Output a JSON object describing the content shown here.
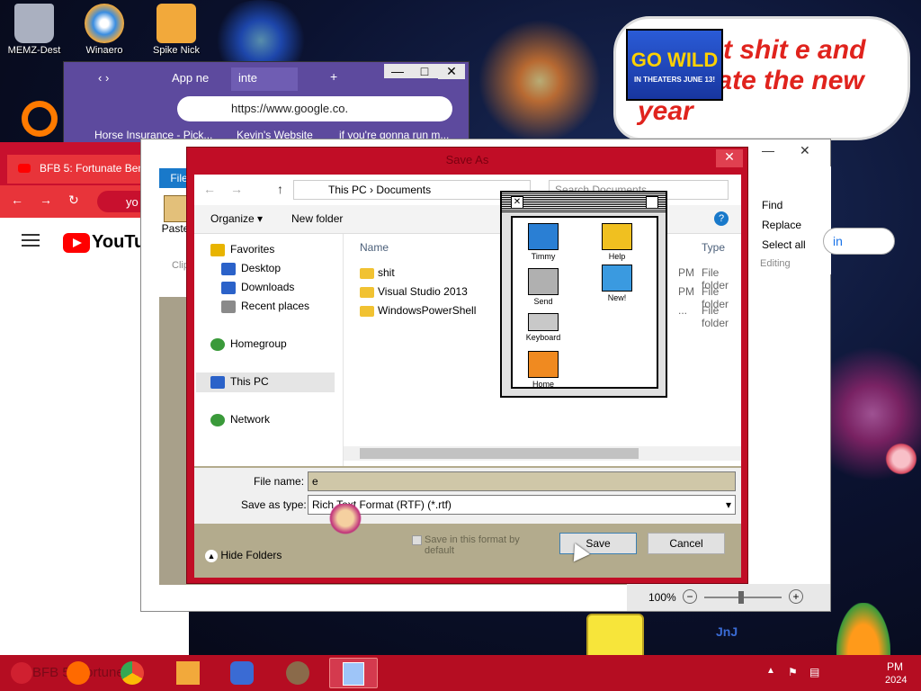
{
  "desktop": {
    "icons": [
      {
        "label": "MEMZ-Dest",
        "color": "#aab0c0"
      },
      {
        "label": "Winaero",
        "color": "#3a8de0"
      },
      {
        "label": "Spike Nick",
        "color": "#f2a93b"
      }
    ]
  },
  "meme": {
    "poster_title": "GO WILD",
    "poster_sub": "IN THEATERS JUNE 13!",
    "text": "e to eat shit e and celebrate the new year"
  },
  "bg_browser": {
    "tabs": [
      "‹ ›",
      "App ne",
      "inte"
    ],
    "address": "https://www.google.co.",
    "bookmarks": [
      "Horse Insurance - Pick...",
      "Kevin's Website",
      "if you're gonna run m..."
    ]
  },
  "red_browser": {
    "tab_title": "BFB 5: Fortunate Ben",
    "address_prefix": "yo",
    "logo": "YouTube"
  },
  "wordpad": {
    "file_tab": "File",
    "paste_label": "Paste",
    "clipboard_label": "Clip",
    "find_label": "Find",
    "replace_label": "Replace",
    "select_all_label": "Select all",
    "editing_label": "Editing",
    "zoom": "100%",
    "sign_in": "in"
  },
  "dialog": {
    "title": "Save As",
    "breadcrumb": [
      "This PC",
      "Documents"
    ],
    "search_placeholder": "Search Documents",
    "organize_label": "Organize",
    "new_folder_label": "New folder",
    "columns": {
      "name": "Name",
      "type": "Type"
    },
    "tree": [
      {
        "label": "Favorites",
        "color": "#e8b400"
      },
      {
        "label": "Desktop",
        "color": "#2b62c9"
      },
      {
        "label": "Downloads",
        "color": "#2b62c9"
      },
      {
        "label": "Recent places",
        "color": "#8a8a8a"
      },
      {
        "label": "Homegroup",
        "color": "#3a9a3a"
      },
      {
        "label": "This PC",
        "color": "#2b62c9"
      },
      {
        "label": "Network",
        "color": "#3a9a3a"
      }
    ],
    "files": [
      {
        "name": "shit",
        "time": "PM",
        "type": "File folder"
      },
      {
        "name": "Visual Studio 2013",
        "time": "PM",
        "type": "File folder"
      },
      {
        "name": "WindowsPowerShell",
        "time": "...",
        "type": "File folder"
      }
    ],
    "file_name_label": "File name:",
    "file_name_value": "e",
    "save_type_label": "Save as type:",
    "save_type_value": "Rich Text Format (RTF) (*.rtf)",
    "default_checkbox_label": "Save in this format by default",
    "hide_folders_label": "Hide Folders",
    "save_label": "Save",
    "cancel_label": "Cancel"
  },
  "mac_window": {
    "icons": [
      {
        "label": "Timmy",
        "color": "#2a7fd4"
      },
      {
        "label": "Help",
        "color": "#f0c020"
      },
      {
        "label": "Send",
        "color": "#b0b0b0"
      },
      {
        "label": "New!",
        "color": "#3a9ae0"
      },
      {
        "label": "Keyboard",
        "color": "#c8c8c8"
      },
      {
        "label": "Home",
        "color": "#f08a20"
      }
    ]
  },
  "taskbar": {
    "bg_label": "BFB 5: Fortune B",
    "clock_line1": "PM",
    "clock_line2": "2024",
    "watermark": "JnJ",
    "colors": [
      "#ff6a00",
      "#34a853",
      "#f2a93b",
      "#3a6bd4",
      "#8a6a4a",
      "#9ec5f8"
    ]
  }
}
